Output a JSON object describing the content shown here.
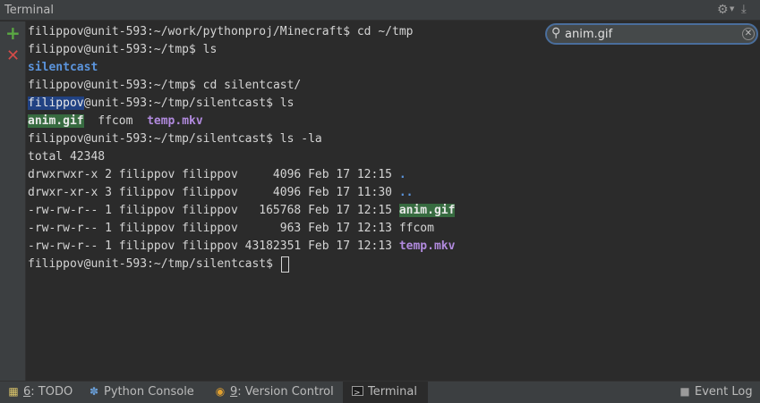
{
  "window": {
    "title": "Terminal"
  },
  "toolbar": {
    "new_session_icon": "plus-icon",
    "close_session_icon": "close-icon"
  },
  "search": {
    "value": "anim.gif",
    "placeholder": ""
  },
  "terminal": {
    "lines": [
      {
        "prompt": "filippov@unit-593:~/work/pythonproj/Minecraft$ ",
        "command": "cd ~/tmp"
      },
      {
        "prompt": "filippov@unit-593:~/tmp$ ",
        "command": "ls"
      },
      {
        "dir": "silentcast"
      },
      {
        "prompt": "filippov@unit-593:~/tmp$ ",
        "command": "cd silentcast/"
      },
      {
        "user": "filippov",
        "rest": "@unit-593:~/tmp/silentcast$ ",
        "command": "ls"
      },
      {
        "files": [
          "anim.gif",
          "ffcom",
          "temp.mkv"
        ]
      },
      {
        "prompt": "filippov@unit-593:~/tmp/silentcast$ ",
        "command": "ls -la"
      },
      {
        "text": "total 42348"
      },
      {
        "meta": "drwxrwxr-x 2 filippov filippov     4096 Feb 17 12:15 ",
        "name": "."
      },
      {
        "meta": "drwxr-xr-x 3 filippov filippov     4096 Feb 17 11:30 ",
        "name": ".."
      },
      {
        "meta": "-rw-rw-r-- 1 filippov filippov   165768 Feb 17 12:15 ",
        "name": "anim.gif"
      },
      {
        "meta": "-rw-rw-r-- 1 filippov filippov      963 Feb 17 12:13 ",
        "name": "ffcom"
      },
      {
        "meta": "-rw-rw-r-- 1 filippov filippov 43182351 Feb 17 12:13 ",
        "name": "temp.mkv"
      },
      {
        "prompt": "filippov@unit-593:~/tmp/silentcast$ "
      }
    ]
  },
  "statusbar": {
    "todo": {
      "mnemonic": "6",
      "label": ": TODO"
    },
    "python_console": "Python Console",
    "version_control": {
      "mnemonic": "9",
      "label": ": Version Control"
    },
    "terminal": "Terminal",
    "event_log": "Event Log"
  },
  "colors": {
    "background": "#2b2b2b",
    "directory": "#5b94dc",
    "video_file": "#b18ade",
    "search_match": "#376b40",
    "selection": "#214283"
  }
}
